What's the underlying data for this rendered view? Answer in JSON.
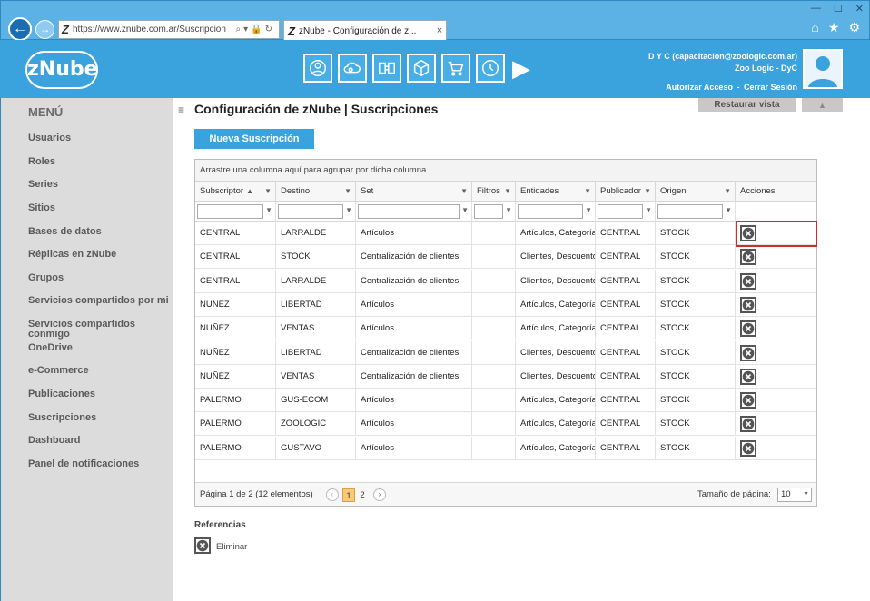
{
  "browser": {
    "url": "https://www.znube.com.ar/Suscripcion",
    "tab_title": "zNube - Configuración de z...",
    "tab_close": "×",
    "win_min": "—",
    "win_max": "☐",
    "win_close": "✕"
  },
  "header": {
    "logo": "zNube",
    "user_line1": "D Y C (capacitacion@zoologic.com.ar)",
    "user_line2": "Zoo Logic - DyC",
    "authorize": "Autorizar Acceso",
    "separator": "-",
    "logout": "Cerrar Sesión",
    "next_icon": "▶"
  },
  "sidebar": {
    "title": "MENÚ",
    "items": [
      "Usuarios",
      "Roles",
      "Series",
      "Sitios",
      "Bases de datos",
      "Réplicas en zNube",
      "Grupos",
      "Servicios compartidos por mi",
      "Servicios compartidos conmigo",
      "OneDrive",
      "e-Commerce",
      "Publicaciones",
      "Suscripciones",
      "Dashboard",
      "Panel de notificaciones"
    ]
  },
  "main": {
    "title": "Configuración de zNube | Suscripciones",
    "restore_view": "Restaurar vista",
    "collapse": "▲",
    "new_button": "Nueva Suscripción"
  },
  "grid": {
    "group_panel": "Arrastre una columna aquí para agrupar por dicha columna",
    "columns": [
      "Subscriptor",
      "Destino",
      "Set",
      "Filtros",
      "Entidades",
      "Publicador",
      "Origen",
      "Acciones"
    ],
    "rows": [
      [
        "CENTRAL",
        "LARRALDE",
        "Artículos",
        "",
        "Artículos, Categorías",
        "CENTRAL",
        "STOCK"
      ],
      [
        "CENTRAL",
        "STOCK",
        "Centralización de clientes",
        "",
        "Clientes, Descuentos",
        "CENTRAL",
        "STOCK"
      ],
      [
        "CENTRAL",
        "LARRALDE",
        "Centralización de clientes",
        "",
        "Clientes, Descuentos",
        "CENTRAL",
        "STOCK"
      ],
      [
        "NUÑEZ",
        "LIBERTAD",
        "Artículos",
        "",
        "Artículos, Categorías",
        "CENTRAL",
        "STOCK"
      ],
      [
        "NUÑEZ",
        "VENTAS",
        "Artículos",
        "",
        "Artículos, Categorías",
        "CENTRAL",
        "STOCK"
      ],
      [
        "NUÑEZ",
        "LIBERTAD",
        "Centralización de clientes",
        "",
        "Clientes, Descuentos",
        "CENTRAL",
        "STOCK"
      ],
      [
        "NUÑEZ",
        "VENTAS",
        "Centralización de clientes",
        "",
        "Clientes, Descuentos",
        "CENTRAL",
        "STOCK"
      ],
      [
        "PALERMO",
        "GUS-ECOM",
        "Artículos",
        "",
        "Artículos, Categorías",
        "CENTRAL",
        "STOCK"
      ],
      [
        "PALERMO",
        "ZOOLOGIC",
        "Artículos",
        "",
        "Artículos, Categorías",
        "CENTRAL",
        "STOCK"
      ],
      [
        "PALERMO",
        "GUSTAVO",
        "Artículos",
        "",
        "Artículos, Categorías",
        "CENTRAL",
        "STOCK"
      ]
    ],
    "sort_indicator": "▲",
    "pager": {
      "info": "Página 1 de 2 (12 elementos)",
      "prev": "‹",
      "pages": [
        "1",
        "2"
      ],
      "next": "›",
      "page_size_label": "Tamaño de página:",
      "page_size": "10"
    }
  },
  "references": {
    "title": "Referencias",
    "delete_label": "Eliminar"
  }
}
